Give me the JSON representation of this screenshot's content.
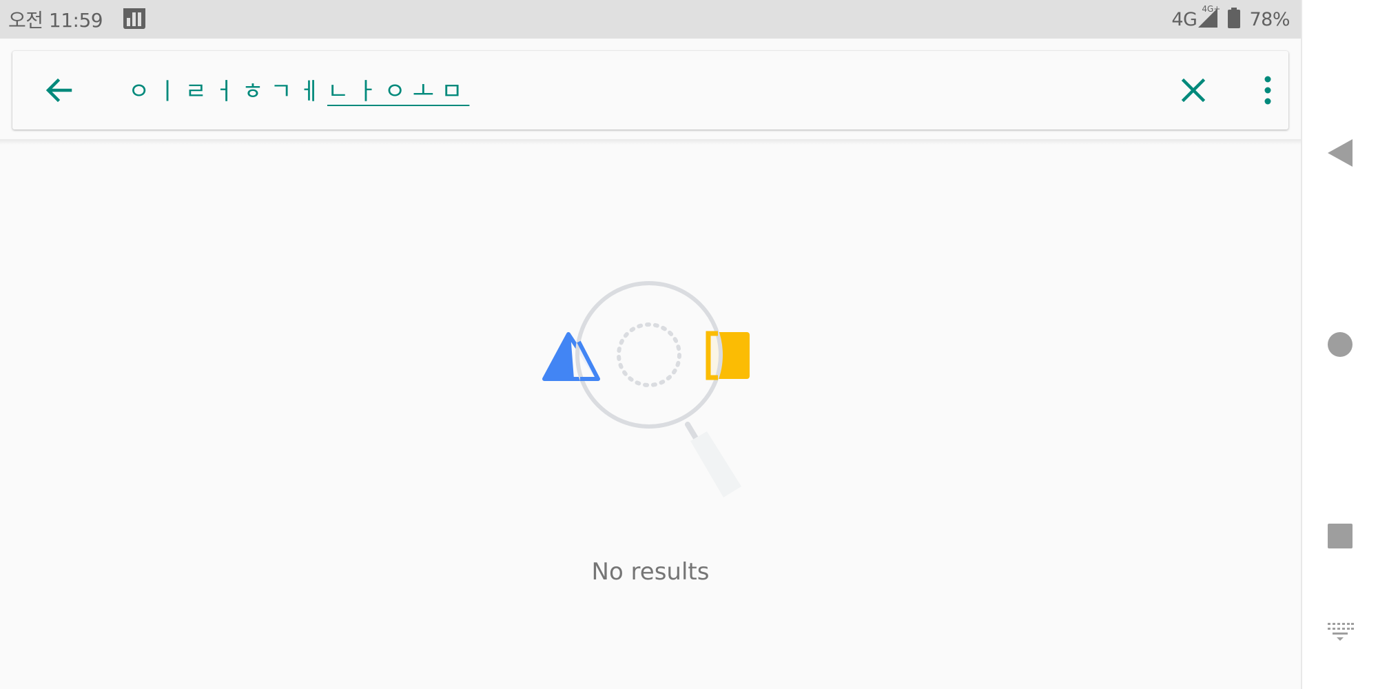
{
  "status_bar": {
    "time": "오전 11:59",
    "network": "4G",
    "network_badge": "4G+",
    "battery": "78%",
    "app_icon": "usage-bars-icon"
  },
  "search": {
    "back_icon": "arrow-back-icon",
    "query_committed": "ㅇㅣㄹㅓㅎㄱㅔ",
    "query_composing": "ㄴㅏㅇㅗㅁ",
    "clear_icon": "close-icon",
    "menu_icon": "more-vert-icon"
  },
  "empty_state": {
    "icon": "no-results-magnifier-icon",
    "message": "No results"
  },
  "nav_bar": {
    "back_icon": "nav-back-icon",
    "home_icon": "nav-home-icon",
    "recents_icon": "nav-recents-icon",
    "keyboard_icon": "keyboard-icon"
  },
  "colors": {
    "accent": "#00897b",
    "status_bar_bg": "#e0e0e0",
    "triangle": "#4285f4",
    "square": "#fbbc04",
    "text_secondary": "#757575"
  }
}
